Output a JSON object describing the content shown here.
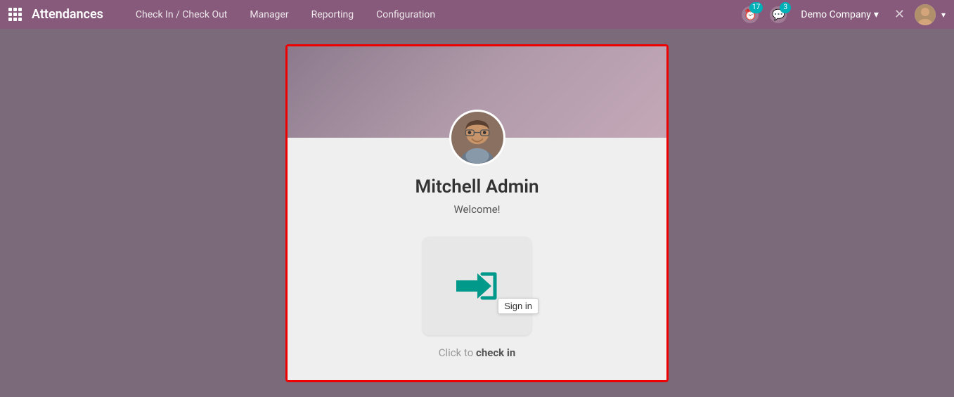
{
  "navbar": {
    "brand": "Attendances",
    "menu": [
      {
        "label": "Check In / Check Out"
      },
      {
        "label": "Manager"
      },
      {
        "label": "Reporting"
      },
      {
        "label": "Configuration"
      }
    ],
    "notifications_count": "17",
    "messages_count": "3",
    "company": "Demo Company",
    "company_chevron": "▾"
  },
  "card": {
    "user_name": "Mitchell Admin",
    "welcome": "Welcome!",
    "checkin_label_prefix": "Click to ",
    "checkin_label_bold": "check in",
    "signin_tooltip": "Sign in"
  }
}
